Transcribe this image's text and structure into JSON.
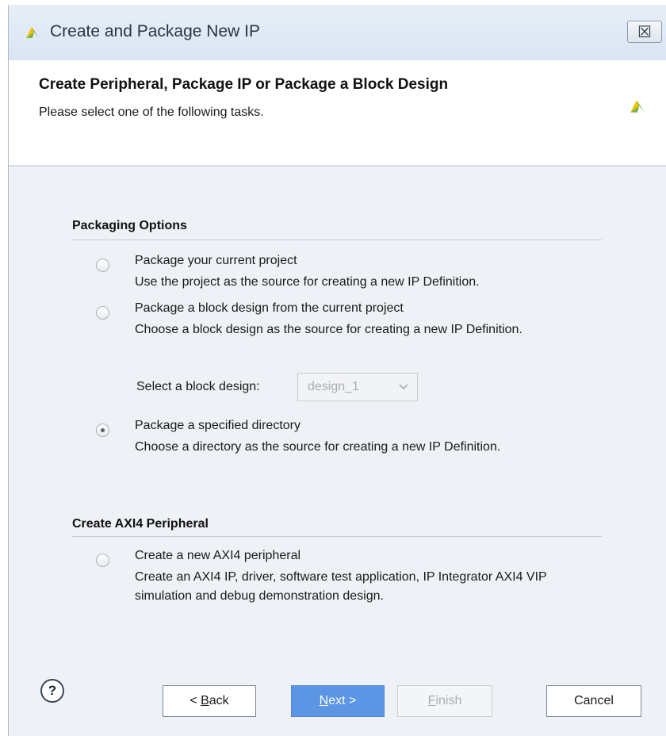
{
  "window": {
    "title": "Create and Package New IP",
    "close_glyph": "☒",
    "title_icon": "vivado-logo-icon",
    "close_icon": "close-icon"
  },
  "header": {
    "title": "Create Peripheral, Package IP or Package a Block Design",
    "subtitle": "Please select one of the following tasks.",
    "logo_icon": "vivado-logo-icon"
  },
  "packaging": {
    "heading": "Packaging Options",
    "options": [
      {
        "label": "Package your current project",
        "description": "Use the project as the source for creating a new IP Definition.",
        "checked": false
      },
      {
        "label": "Package a block design from the current project",
        "description": "Choose a block design as the source for creating a new IP Definition.",
        "checked": false
      },
      {
        "label": "Package a specified directory",
        "description": "Choose a directory as the source for creating a new IP Definition.",
        "checked": true
      }
    ],
    "block_design_select": {
      "label": "Select a block design:",
      "value": "design_1",
      "enabled": false
    }
  },
  "axi": {
    "heading": "Create AXI4 Peripheral",
    "options": [
      {
        "label": "Create a new AXI4 peripheral",
        "description": "Create an AXI4 IP, driver, software test application, IP Integrator AXI4 VIP simulation and debug demonstration design.",
        "checked": false
      }
    ]
  },
  "footer": {
    "help_glyph": "?",
    "back": {
      "prefix": "< ",
      "mnemonic": "B",
      "rest": "ack"
    },
    "next": {
      "mnemonic": "N",
      "rest": "ext >"
    },
    "finish": {
      "mnemonic": "F",
      "rest": "inish",
      "enabled": false
    },
    "cancel": "Cancel"
  },
  "colors": {
    "accent": "#5b95e4",
    "logo_yellow": "#f2c200",
    "logo_green": "#3a8d1c"
  }
}
